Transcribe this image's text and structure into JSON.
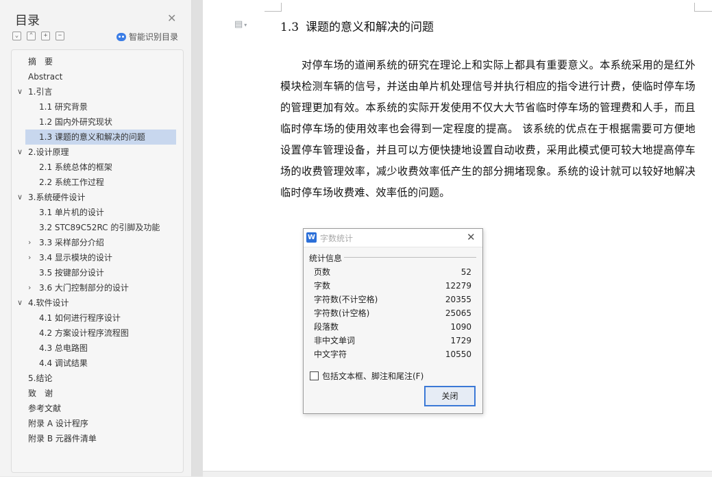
{
  "nav": {
    "title": "目录",
    "tools": {
      "collapse": "⌄",
      "expand_all": "⌃",
      "add": "+",
      "remove": "−"
    },
    "smart_toc_label": "智能识别目录",
    "items": [
      {
        "label": "摘　要",
        "level": 0,
        "chevron": "",
        "selected": false
      },
      {
        "label": "Abstract",
        "level": 0,
        "chevron": "",
        "selected": false
      },
      {
        "label": "1.引言",
        "level": 0,
        "chevron": "∨",
        "selected": false
      },
      {
        "label": "1.1  研究背景",
        "level": 1,
        "chevron": "",
        "selected": false
      },
      {
        "label": "1.2  国内外研究现状",
        "level": 1,
        "chevron": "",
        "selected": false
      },
      {
        "label": "1.3  课题的意义和解决的问题",
        "level": 1,
        "chevron": "",
        "selected": true
      },
      {
        "label": "2.设计原理",
        "level": 0,
        "chevron": "∨",
        "selected": false
      },
      {
        "label": "2.1  系统总体的框架",
        "level": 1,
        "chevron": "",
        "selected": false
      },
      {
        "label": "2.2  系统工作过程",
        "level": 1,
        "chevron": "",
        "selected": false
      },
      {
        "label": "3.系统硬件设计",
        "level": 0,
        "chevron": "∨",
        "selected": false
      },
      {
        "label": "3.1  单片机的设计",
        "level": 1,
        "chevron": "",
        "selected": false
      },
      {
        "label": "3.2 STC89C52RC 的引脚及功能",
        "level": 1,
        "chevron": "",
        "selected": false
      },
      {
        "label": "3.3  采样部分介绍",
        "level": 1,
        "chevron": "›",
        "selected": false
      },
      {
        "label": "3.4  显示模块的设计",
        "level": 1,
        "chevron": "›",
        "selected": false
      },
      {
        "label": "3.5  按键部分设计",
        "level": 1,
        "chevron": "",
        "selected": false
      },
      {
        "label": "3.6  大门控制部分的设计",
        "level": 1,
        "chevron": "›",
        "selected": false
      },
      {
        "label": "4.软件设计",
        "level": 0,
        "chevron": "∨",
        "selected": false
      },
      {
        "label": "4.1  如何进行程序设计",
        "level": 1,
        "chevron": "",
        "selected": false
      },
      {
        "label": "4.2  方案设计程序流程图",
        "level": 1,
        "chevron": "",
        "selected": false
      },
      {
        "label": "4.3  总电路图",
        "level": 1,
        "chevron": "",
        "selected": false
      },
      {
        "label": "4.4  调试结果",
        "level": 1,
        "chevron": "",
        "selected": false
      },
      {
        "label": "5.结论",
        "level": 0,
        "chevron": "",
        "selected": false
      },
      {
        "label": "致　谢",
        "level": 0,
        "chevron": "",
        "selected": false
      },
      {
        "label": "参考文献",
        "level": 0,
        "chevron": "",
        "selected": false
      },
      {
        "label": "附录 A 设计程序",
        "level": 0,
        "chevron": "",
        "selected": false
      },
      {
        "label": "附录 B 元器件清单",
        "level": 0,
        "chevron": "",
        "selected": false
      }
    ]
  },
  "document": {
    "heading_number": "1.3",
    "heading_text": "课题的意义和解决的问题",
    "paragraph": "对停车场的道闸系统的研究在理论上和实际上都具有重要意义。本系统采用的是红外模块检测车辆的信号，并送由单片机处理信号并执行相应的指令进行计费，使临时停车场的管理更加有效。本系统的实际开发使用不仅大大节省临时停车场的管理费和人手，而且临时停车场的使用效率也会得到一定程度的提高。 该系统的优点在于根据需要可方便地设置停车管理设备，并且可以方便快捷地设置自动收费，采用此模式便可较大地提高停车场的收费管理效率，减少收费效率低产生的部分拥堵现象。系统的设计就可以较好地解决临时停车场收费难、效率低的问题。"
  },
  "dialog": {
    "logo": "W",
    "title": "字数统计",
    "group_label": "统计信息",
    "stats": [
      {
        "label": "页数",
        "value": "52"
      },
      {
        "label": "字数",
        "value": "12279"
      },
      {
        "label": "字符数(不计空格)",
        "value": "20355"
      },
      {
        "label": "字符数(计空格)",
        "value": "25065"
      },
      {
        "label": "段落数",
        "value": "1090"
      },
      {
        "label": "非中文单词",
        "value": "1729"
      },
      {
        "label": "中文字符",
        "value": "10550"
      }
    ],
    "checkbox_label": "包括文本框、脚注和尾注(F)",
    "checkbox_checked": false,
    "close_label": "关闭"
  }
}
